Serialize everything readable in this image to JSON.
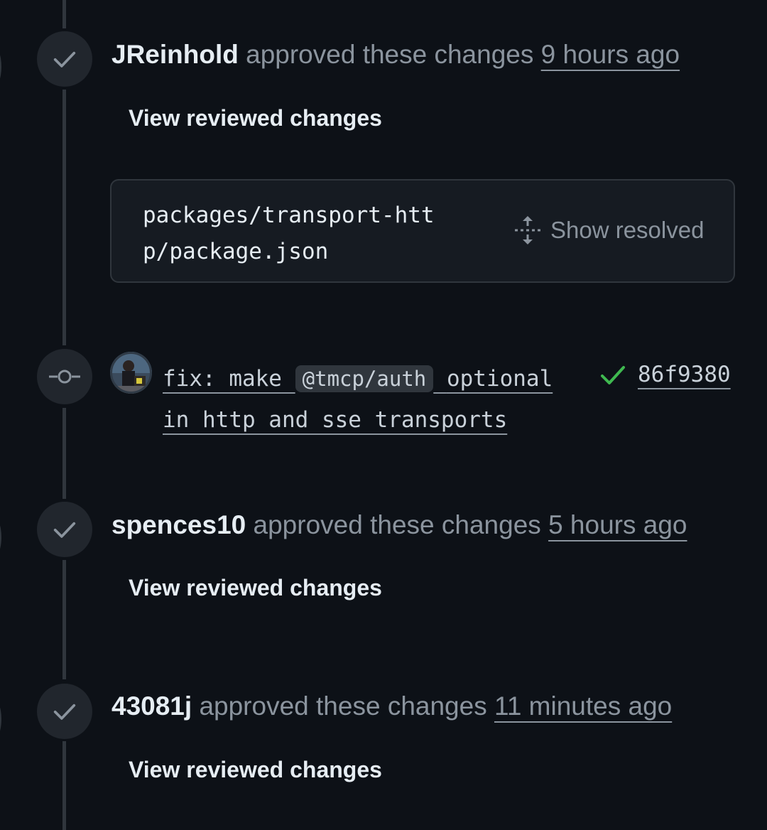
{
  "timeline": {
    "reviews": [
      {
        "author": "JReinhold",
        "action": "approved these changes",
        "time": "9 hours ago",
        "link": "View reviewed changes"
      },
      {
        "author": "spences10",
        "action": "approved these changes",
        "time": "5 hours ago",
        "link": "View reviewed changes"
      },
      {
        "author": "43081j",
        "action": "approved these changes",
        "time": "11 minutes ago",
        "link": "View reviewed changes"
      }
    ],
    "file_thread": {
      "path_line1": "packages/transport-htt",
      "path_line2": "p/package.json",
      "show_resolved": "Show resolved"
    },
    "commit": {
      "msg_part1": "fix: make",
      "code": "@tmcp/auth",
      "msg_part2": "optional",
      "msg_line2": "in http and sse transports",
      "status": "success",
      "sha": "86f9380"
    }
  },
  "colors": {
    "background": "#0d1117",
    "badge": "#21262d",
    "line": "#30363d",
    "text": "#e6edf3",
    "muted": "#8b949e",
    "success": "#3fb950"
  }
}
